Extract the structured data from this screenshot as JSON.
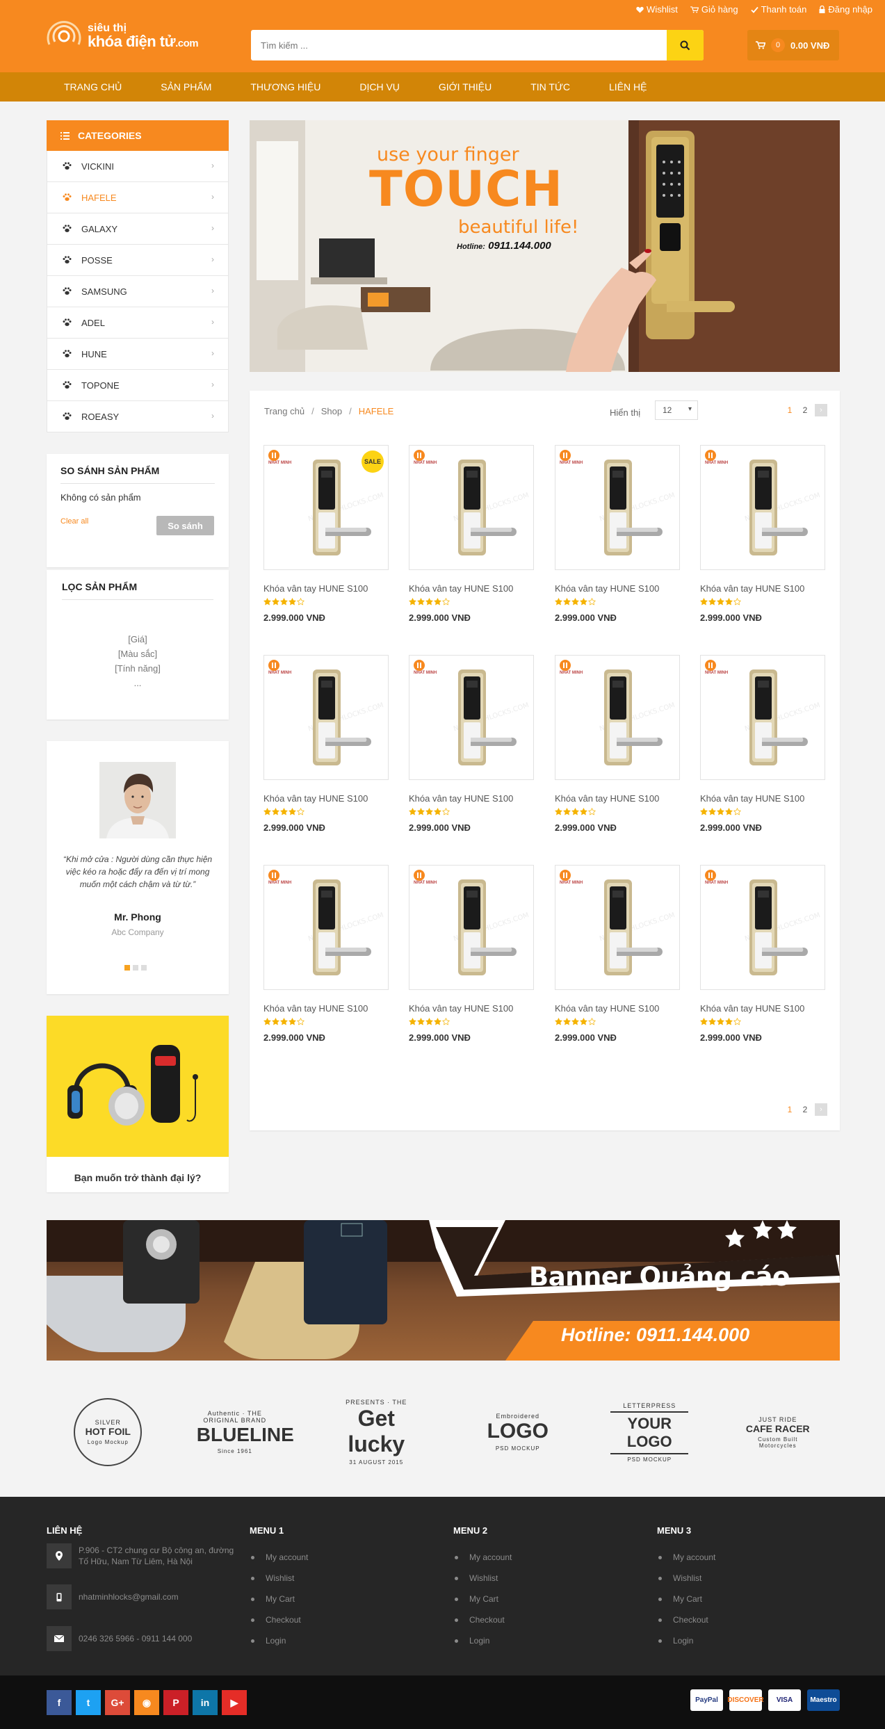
{
  "top_links": [
    "Wishlist",
    "Giỏ hàng",
    "Thanh toán",
    "Đăng nhập"
  ],
  "logo": {
    "line1": "siêu thị",
    "line2": "khóa điện tử",
    "suffix": ".com"
  },
  "search": {
    "placeholder": "Tìm kiếm ..."
  },
  "cart": {
    "count": "0",
    "total": "0.00 VNĐ"
  },
  "nav": [
    "TRANG CHỦ",
    "SẢN PHẨM",
    "THƯƠNG HIỆU",
    "DỊCH VỤ",
    "GIỚI THIỆU",
    "TIN TỨC",
    "LIÊN HỆ"
  ],
  "categories": {
    "title": "CATEGORIES",
    "items": [
      "VICKINI",
      "HAFELE",
      "GALAXY",
      "POSSE",
      "SAMSUNG",
      "ADEL",
      "HUNE",
      "TOPONE",
      "ROEASY"
    ],
    "active": "HAFELE"
  },
  "compare": {
    "title": "SO SÁNH SẢN PHẨM",
    "empty": "Không có sản phẩm",
    "clear": "Clear all",
    "button": "So sánh"
  },
  "filter": {
    "title": "LỌC SẢN PHẨM",
    "items": [
      "[Giá]",
      "[Màu sắc]",
      "[Tính năng]",
      "..."
    ]
  },
  "testimonial": {
    "quote": "“Khi mở cửa : Người dùng cần thực hiện việc kéo ra hoặc đẩy ra đến vị trí mong muốn một cách chậm và từ từ.”",
    "name": "Mr. Phong",
    "company": "Abc Company"
  },
  "promo": {
    "text": "Bạn muốn trở thành đại lý?"
  },
  "hero": {
    "line1": "use your finger",
    "line2": "TOUCH",
    "line3": "beautiful life!",
    "hotline_label": "Hotline:",
    "hotline": "0911.144.000"
  },
  "breadcrumb": [
    "Trang chủ",
    "Shop",
    "HAFELE"
  ],
  "show": {
    "label": "Hiển thị",
    "value": "12"
  },
  "pagination": {
    "pages": [
      "1",
      "2"
    ],
    "current": "1",
    "next": "›"
  },
  "products": [
    {
      "name": "Khóa vân tay HUNE S100",
      "price": "2.999.000 VNĐ",
      "rating": 4,
      "badge": "SALE"
    },
    {
      "name": "Khóa vân tay HUNE S100",
      "price": "2.999.000 VNĐ",
      "rating": 4
    },
    {
      "name": "Khóa vân tay HUNE S100",
      "price": "2.999.000 VNĐ",
      "rating": 4
    },
    {
      "name": "Khóa vân tay HUNE S100",
      "price": "2.999.000 VNĐ",
      "rating": 4
    },
    {
      "name": "Khóa vân tay HUNE S100",
      "price": "2.999.000 VNĐ",
      "rating": 4
    },
    {
      "name": "Khóa vân tay HUNE S100",
      "price": "2.999.000 VNĐ",
      "rating": 4
    },
    {
      "name": "Khóa vân tay HUNE S100",
      "price": "2.999.000 VNĐ",
      "rating": 4
    },
    {
      "name": "Khóa vân tay HUNE S100",
      "price": "2.999.000 VNĐ",
      "rating": 4
    },
    {
      "name": "Khóa vân tay HUNE S100",
      "price": "2.999.000 VNĐ",
      "rating": 4
    },
    {
      "name": "Khóa vân tay HUNE S100",
      "price": "2.999.000 VNĐ",
      "rating": 4
    },
    {
      "name": "Khóa vân tay HUNE S100",
      "price": "2.999.000 VNĐ",
      "rating": 4
    },
    {
      "name": "Khóa vân tay HUNE S100",
      "price": "2.999.000 VNĐ",
      "rating": 4
    }
  ],
  "product_brand": "NHAT MINH",
  "banner": {
    "title": "Banner Quảng cáo",
    "hotline": "Hotline:  0911.144.000"
  },
  "brand_logos": [
    {
      "top": "SILVER",
      "main": "HOT FOIL",
      "sub": "Logo Mockup"
    },
    {
      "top": "Authentic · THE ORIGINAL BRAND",
      "main": "BLUELINE",
      "sub": "Since 1961"
    },
    {
      "top": "PRESENTS · THE",
      "main": "Get lucky",
      "sub": "31 AUGUST 2015"
    },
    {
      "top": "Embroidered",
      "main": "LOGO",
      "sub": "PSD MOCKUP"
    },
    {
      "top": "LETTERPRESS",
      "main": "YOUR LOGO",
      "sub": "PSD MOCKUP"
    },
    {
      "top": "JUST RIDE",
      "main": "CAFE RACER",
      "sub": "Custom Built Motorcycles"
    }
  ],
  "footer": {
    "contact": {
      "title": "LIÊN HỆ",
      "address": "P.906 - CT2 chung cư Bộ công an, đường Tố Hữu, Nam Từ Liêm, Hà Nội",
      "email": "nhatminhlocks@gmail.com",
      "phone": "0246 326 5966 - 0911 144 000"
    },
    "menus": [
      {
        "title": "MENU 1",
        "items": [
          "My account",
          "Wishlist",
          "My Cart",
          "Checkout",
          "Login"
        ]
      },
      {
        "title": "MENU 2",
        "items": [
          "My account",
          "Wishlist",
          "My Cart",
          "Checkout",
          "Login"
        ]
      },
      {
        "title": "MENU 3",
        "items": [
          "My account",
          "Wishlist",
          "My Cart",
          "Checkout",
          "Login"
        ]
      }
    ]
  },
  "social": [
    {
      "icon": "facebook-icon",
      "glyph": "f",
      "color": "#3b5998"
    },
    {
      "icon": "twitter-icon",
      "glyph": "t",
      "color": "#1da1f2"
    },
    {
      "icon": "google-plus-icon",
      "glyph": "G+",
      "color": "#dd4b39"
    },
    {
      "icon": "rss-icon",
      "glyph": "◉",
      "color": "#f7891f"
    },
    {
      "icon": "pinterest-icon",
      "glyph": "P",
      "color": "#cb2027"
    },
    {
      "icon": "linkedin-icon",
      "glyph": "in",
      "color": "#0e76a8"
    },
    {
      "icon": "youtube-icon",
      "glyph": "▶",
      "color": "#e52d27"
    }
  ],
  "payments": [
    "PayPal",
    "DISCOVER",
    "VISA",
    "Maestro"
  ],
  "colors": {
    "brand": "#f7891f",
    "nav": "#d28507",
    "accent": "#fcd314",
    "footer": "#262626"
  }
}
